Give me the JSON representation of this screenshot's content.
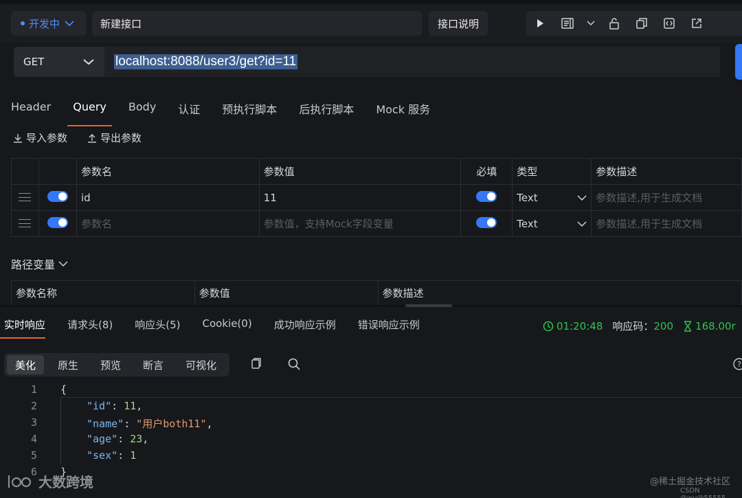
{
  "header": {
    "status_label": "开发中",
    "api_name": "新建接口",
    "doc_button": "接口说明"
  },
  "request": {
    "method": "GET",
    "url": "localhost:8088/user3/get?id=11"
  },
  "tabs": [
    "Header",
    "Query",
    "Body",
    "认证",
    "预执行脚本",
    "后执行脚本",
    "Mock 服务"
  ],
  "active_tab": "Query",
  "param_actions": {
    "import": "导入参数",
    "export": "导出参数"
  },
  "query_table": {
    "headers": [
      "参数名",
      "参数值",
      "必填",
      "类型",
      "参数描述"
    ],
    "rows": [
      {
        "name": "id",
        "value": "11",
        "type": "Text",
        "desc_placeholder": "参数描述,用于生成文档"
      },
      {
        "name_placeholder": "参数名",
        "value_placeholder": "参数值，支持Mock字段变量",
        "type": "Text",
        "desc_placeholder": "参数描述,用于生成文档"
      }
    ]
  },
  "path_vars": {
    "title": "路径变量",
    "headers": [
      "参数名称",
      "参数值",
      "参数描述"
    ]
  },
  "response_tabs": [
    "实时响应",
    "请求头(8)",
    "响应头(5)",
    "Cookie(0)",
    "成功响应示例",
    "错误响应示例"
  ],
  "response_meta": {
    "time": "01:20:48",
    "code_label": "响应码：",
    "code": "200",
    "duration": "168.00r"
  },
  "view_modes": [
    "美化",
    "原生",
    "预览",
    "断言",
    "可视化"
  ],
  "code_lines": [
    "1",
    "2",
    "3",
    "4",
    "5",
    "6"
  ],
  "json_body": {
    "open": "{",
    "id_key": "\"id\"",
    "id_val": "11",
    "name_key": "\"name\"",
    "name_val": "\"用户both11\"",
    "age_key": "\"age\"",
    "age_val": "23",
    "sex_key": "\"sex\"",
    "sex_val": "1",
    "close": "}"
  },
  "watermarks": {
    "logo_text": "大数跨境",
    "community": "@稀土掘金技术社区",
    "author": "CSDN @wu@55555"
  }
}
